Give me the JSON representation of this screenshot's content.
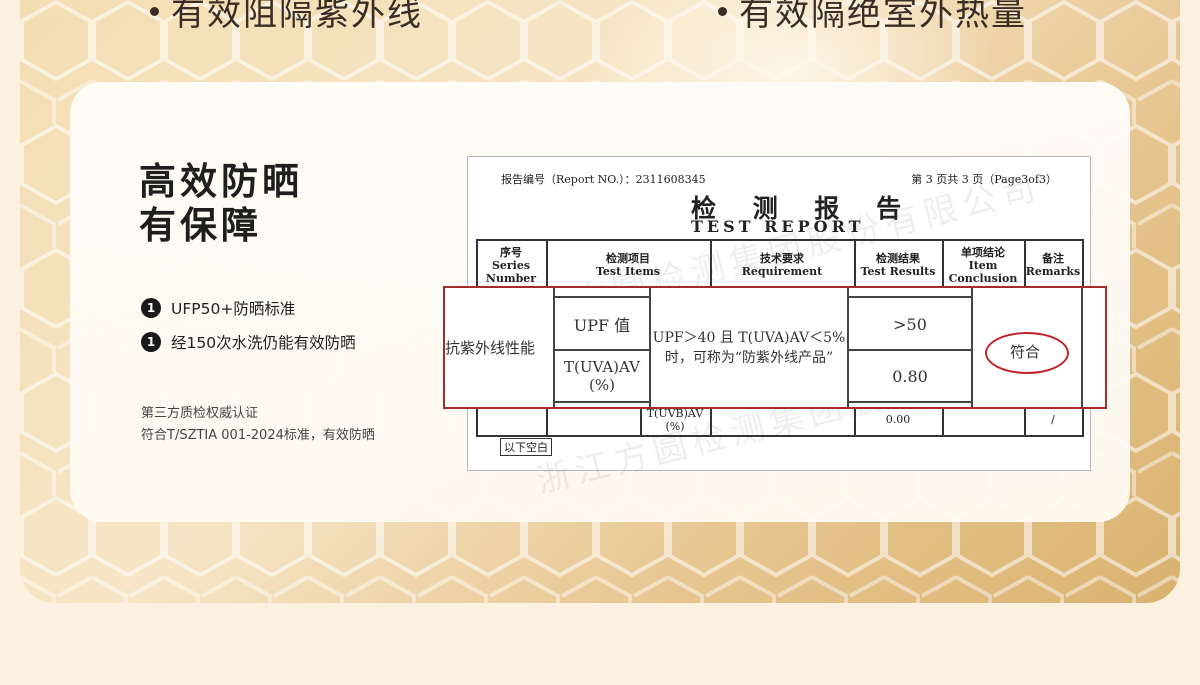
{
  "top_bullets": [
    {
      "text": "有效阻隔紫外线"
    },
    {
      "text": "有效隔绝室外热量"
    }
  ],
  "headline": {
    "line1": "高效防晒",
    "line2": "有保障"
  },
  "features": [
    {
      "num": "1",
      "text": "UFP50+防晒标准"
    },
    {
      "num": "1",
      "text": "经150次水洗仍能有效防晒"
    }
  ],
  "certification": {
    "line1": "第三方质检权威认证",
    "line2": "符合T/SZTIA 001-2024标准，有效防晒"
  },
  "report": {
    "report_no": "报告编号（Report NO.）：2311608345",
    "page_info": "第 3 页共 3 页（Page3of3）",
    "title_cn": "检 测 报 告",
    "title_en": "TEST    REPORT",
    "watermark": "浙江方圆检测集团股份有限公司",
    "headers": {
      "series_cn": "序号",
      "series_en": "Series Number",
      "items_cn": "检测项目",
      "items_en": "Test Items",
      "req_cn": "技术要求",
      "req_en": "Requirement",
      "results_cn": "检测结果",
      "results_en": "Test Results",
      "conclusion_cn": "单项结论",
      "conclusion_en": "Item Conclusion",
      "remarks_cn": "备注",
      "remarks_en": "Remarks"
    },
    "uvb_label": "T(UVB)AV (%)",
    "uvb_value": "0.00",
    "uvb_remark": "/",
    "blank_note": "以下空白"
  },
  "zoom": {
    "category": "抗紫外线性能",
    "item_upf": "UPF 值",
    "item_tuva": "T(UVA)AV (%)",
    "requirement": "UPF＞40 且 T(UVA)AV＜5% 时，可称为“防紫外线产品”",
    "result_upf": ">50",
    "result_tuva": "0.80",
    "conclusion": "符合",
    "colors": {
      "frame": "#a52a2a",
      "stamp": "#c0242a"
    }
  }
}
